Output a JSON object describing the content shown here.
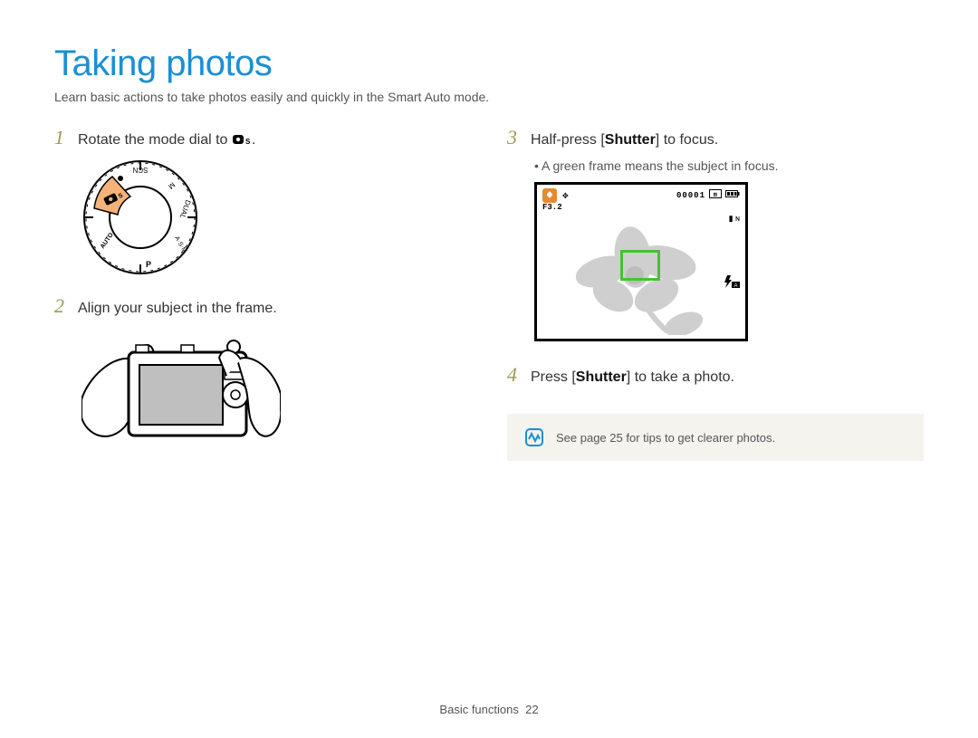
{
  "title": "Taking photos",
  "intro": "Learn basic actions to take photos easily and quickly in the Smart Auto mode.",
  "left": {
    "step1": {
      "num": "1",
      "text_pre": "Rotate the mode dial to ",
      "text_post": "."
    },
    "step2": {
      "num": "2",
      "text": "Align your subject in the frame."
    }
  },
  "right": {
    "step3": {
      "num": "3",
      "text_pre": "Half-press [",
      "bold": "Shutter",
      "text_post": "] to focus.",
      "sub": "A green frame means the subject in focus."
    },
    "screen": {
      "counter": "00001",
      "fvalue": "F3.2"
    },
    "step4": {
      "num": "4",
      "text_pre": "Press [",
      "bold": "Shutter",
      "text_post": "] to take a photo."
    }
  },
  "note": "See page 25 for tips to get clearer photos.",
  "footer": {
    "section": "Basic functions",
    "page": "22"
  }
}
